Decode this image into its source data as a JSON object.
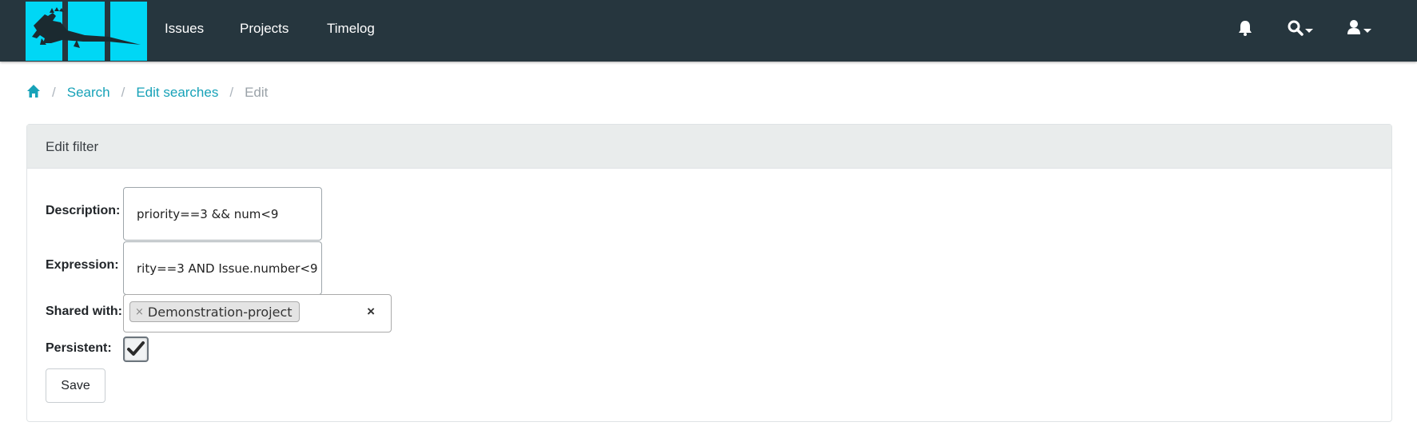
{
  "navbar": {
    "links": [
      "Issues",
      "Projects",
      "Timelog"
    ],
    "icons": [
      "bell-icon",
      "search-icon",
      "user-icon"
    ]
  },
  "breadcrumb": {
    "items": [
      "Search",
      "Edit searches"
    ],
    "current": "Edit"
  },
  "card": {
    "title": "Edit filter"
  },
  "form": {
    "description_label": "Description:",
    "description_value": "priority==3 && num<9",
    "expression_label": "Expression:",
    "expression_value": "rity==3 AND Issue.number<9",
    "shared_label": "Shared with:",
    "shared_tag": "Demonstration-project",
    "tag_remove": "×",
    "clear": "×",
    "persistent_label": "Persistent:",
    "persistent_checked": true,
    "save_label": "Save"
  },
  "colors": {
    "navbar": "#26363e",
    "logo": "#00d7f5",
    "link": "#17a2b8"
  }
}
